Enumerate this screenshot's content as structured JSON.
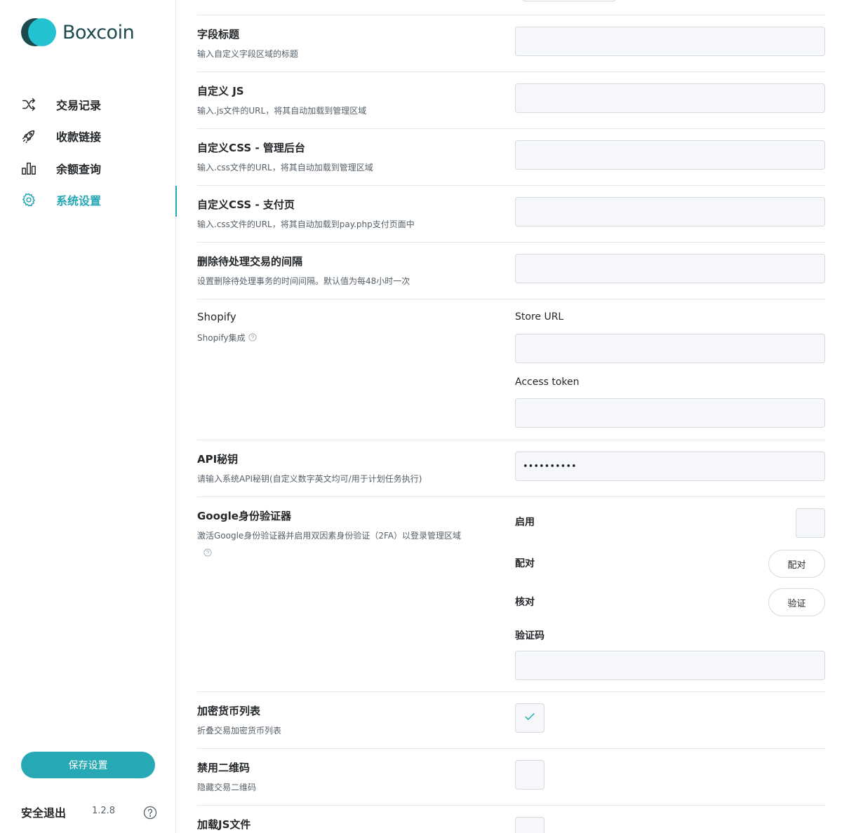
{
  "brand": {
    "name": "Boxcoin"
  },
  "nav": {
    "items": [
      {
        "label": "交易记录",
        "icon": "shuffle-icon"
      },
      {
        "label": "收款链接",
        "icon": "rocket-icon"
      },
      {
        "label": "余额查询",
        "icon": "bar-chart-icon"
      },
      {
        "label": "系统设置",
        "icon": "gear-icon"
      }
    ]
  },
  "sidebar": {
    "save_label": "保存设置",
    "logout_label": "安全退出",
    "version": "1.2.8",
    "help_icon": "question-circle-icon"
  },
  "settings": {
    "field_title": {
      "title": "字段标题",
      "desc": "输入自定义字段区域的标题",
      "value": ""
    },
    "custom_js": {
      "title": "自定义 JS",
      "desc": "输入.js文件的URL，将其自动加载到管理区域",
      "value": ""
    },
    "custom_css_admin": {
      "title": "自定义CSS - 管理后台",
      "desc": "输入.css文件的URL，将其自动加载到管理区域",
      "value": ""
    },
    "custom_css_pay": {
      "title": "自定义CSS - 支付页",
      "desc": "输入.css文件的URL，将其自动加载到pay.php支付页面中",
      "value": ""
    },
    "delete_pending": {
      "title": "删除待处理交易的间隔",
      "desc": "设置删除待处理事务的时间间隔。默认值为每48小时一次",
      "value": ""
    },
    "shopify": {
      "title": "Shopify",
      "desc": "Shopify集成",
      "store_url_label": "Store URL",
      "store_url_value": "",
      "access_token_label": "Access token",
      "access_token_value": ""
    },
    "api_key": {
      "title": "API秘钥",
      "desc": "请输入系统API秘钥(自定义数字英文均可/用于计划任务执行)",
      "value": "••••••••••"
    },
    "google_auth": {
      "title": "Google身份验证器",
      "desc": "激活Google身份验证器并启用双因素身份验证（2FA）以登录管理区域",
      "enable_label": "启用",
      "pair_label": "配对",
      "pair_button": "配对",
      "check_label": "核对",
      "verify_button": "验证",
      "code_label": "验证码",
      "code_value": ""
    },
    "crypto_list": {
      "title": "加密货币列表",
      "desc": "折叠交易加密货币列表",
      "checked": true
    },
    "disable_qr": {
      "title": "禁用二维码",
      "desc": "隐藏交易二维码",
      "checked": false
    },
    "load_js": {
      "title": "加载JS文件"
    }
  },
  "colors": {
    "accent": "#22a6b3",
    "brand_dark": "#1c4a4f",
    "brand_light": "#22c2d0"
  }
}
